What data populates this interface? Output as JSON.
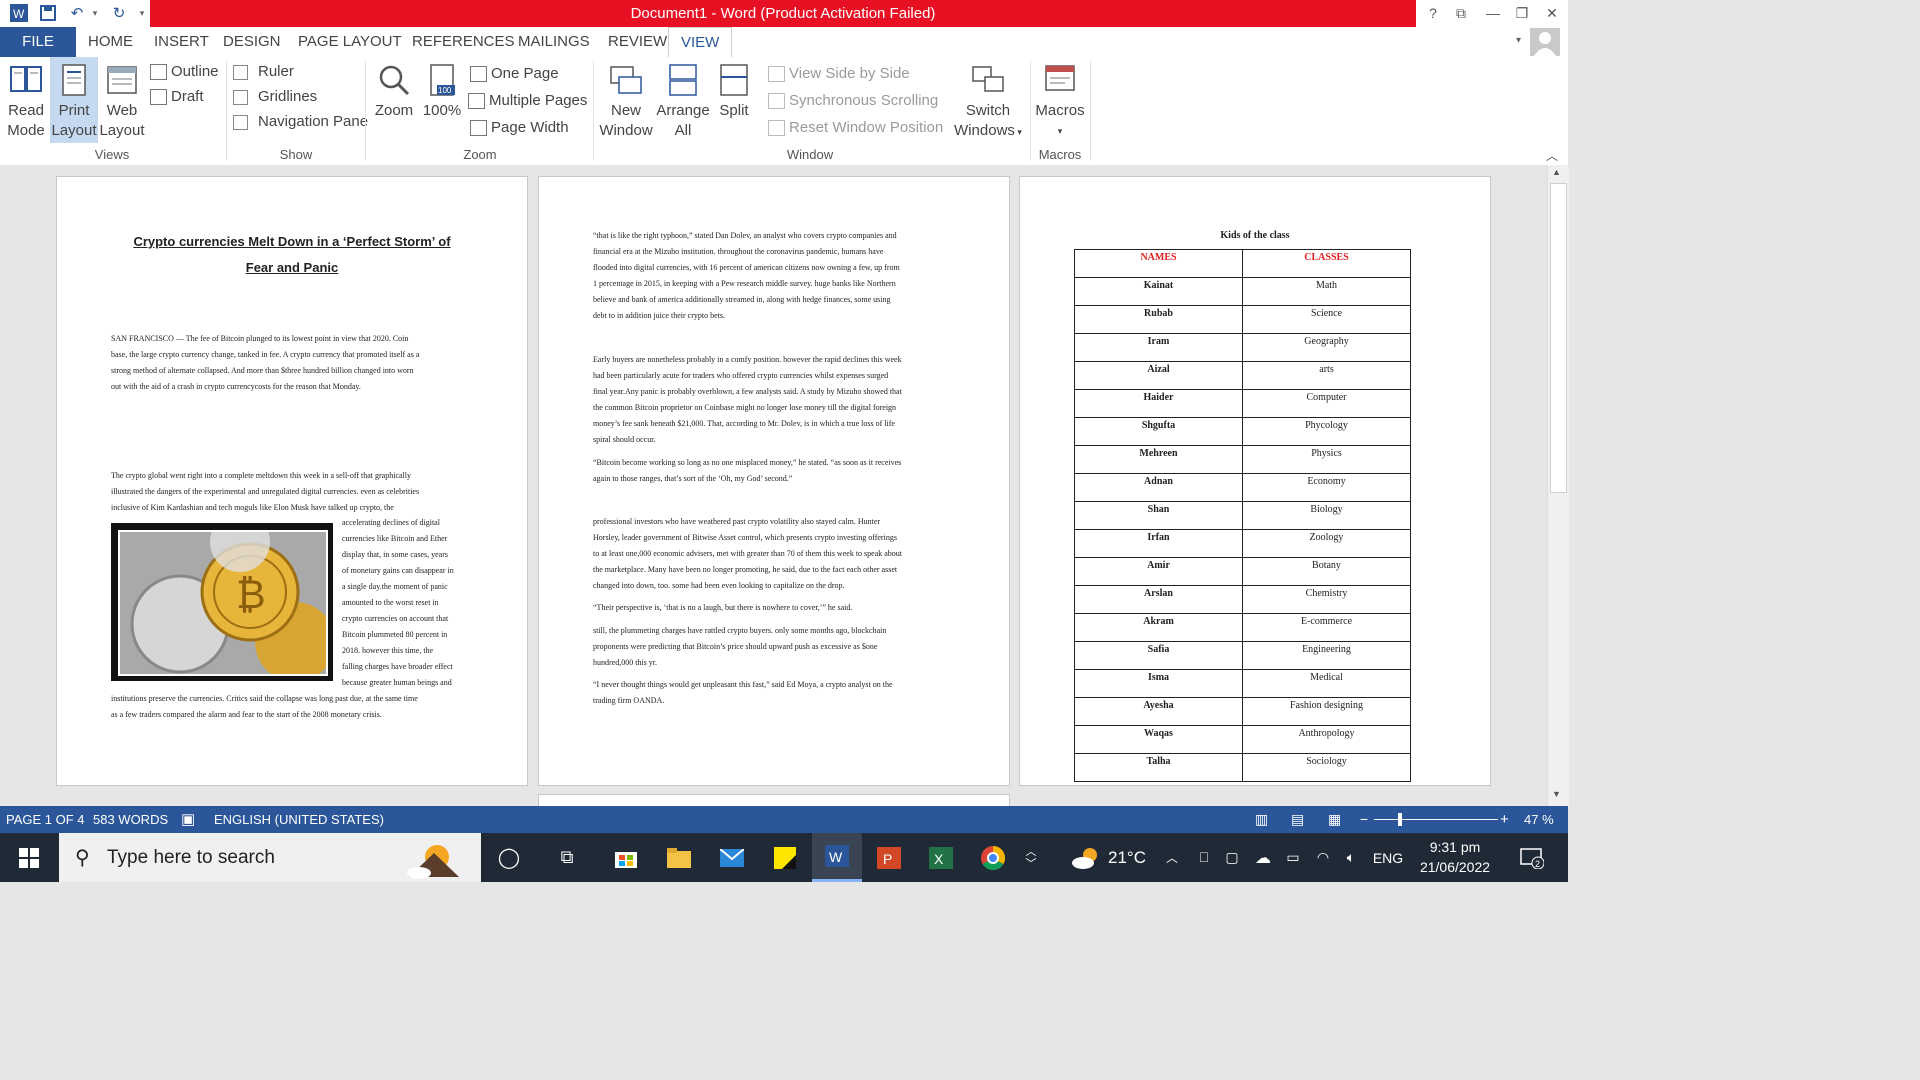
{
  "window": {
    "title": "Document1  -  Word (Product Activation Failed)",
    "help": "?"
  },
  "tabs": [
    "FILE",
    "HOME",
    "INSERT",
    "DESIGN",
    "PAGE LAYOUT",
    "REFERENCES",
    "MAILINGS",
    "REVIEW",
    "VIEW"
  ],
  "ribbon": {
    "views": {
      "label": "Views",
      "read_mode": [
        "Read",
        "Mode"
      ],
      "print_layout": [
        "Print",
        "Layout"
      ],
      "web_layout": [
        "Web",
        "Layout"
      ],
      "outline": "Outline",
      "draft": "Draft"
    },
    "show": {
      "label": "Show",
      "ruler": "Ruler",
      "gridlines": "Gridlines",
      "nav_pane": "Navigation Pane"
    },
    "zoom": {
      "label": "Zoom",
      "zoom": "Zoom",
      "hundred": "100%",
      "hundred_badge": "100",
      "one_page": "One Page",
      "multiple_pages": "Multiple Pages",
      "page_width": "Page Width"
    },
    "window": {
      "label": "Window",
      "new_window": [
        "New",
        "Window"
      ],
      "arrange_all": [
        "Arrange",
        "All"
      ],
      "split": "Split",
      "side_by_side": "View Side by Side",
      "sync_scroll": "Synchronous Scrolling",
      "reset_position": "Reset Window Position",
      "switch_windows": [
        "Switch",
        "Windows"
      ]
    },
    "macros": {
      "label": "Macros",
      "macros": "Macros"
    }
  },
  "page1": {
    "title_line1": "Crypto currencies Melt Down in a ‘Perfect Storm’ of",
    "title_line2": "Fear and Panic",
    "p1": [
      "SAN FRANCISCO — The fee of Bitcoin plunged to its lowest point in view that 2020. Coin",
      "base, the large crypto currency change, tanked in fee. A crypto currency that promoted itself as a",
      "strong method of alternate collapsed. And more than $three hundred billion changed into worn",
      "out with the aid of a crash in crypto currencycosts for the reason that Monday."
    ],
    "p2_top": [
      "The crypto global went right into a complete meltdown this week in a sell-off that graphically",
      "illustrated the dangers of the experimental and unregulated digital currencies. even as celebrities",
      "inclusive of Kim Kardashian and tech moguls like Elon Musk have talked up crypto, the"
    ],
    "p2_side": [
      "accelerating declines of digital",
      "currencies like Bitcoin and Ether",
      "display that, in some cases, years",
      "of monetary gains can disappear in",
      "a single day.the moment of panic",
      "amounted to the worst reset in",
      "crypto currencies on account that",
      "Bitcoin plummeted 80 percent in",
      "2018. however this time, the",
      "falling charges have broader effect",
      "because greater human beings and"
    ],
    "p2_bottom": [
      "institutions preserve the currencies. Critics said the collapse was long past due, at the same time",
      "as a few traders compared the alarm and fear to the start of the 2008 monetary crisis."
    ]
  },
  "page2": {
    "p1": [
      "“that is like the right typhoon,” stated Dan Dolev, an analyst who covers crypto companies and",
      "financial era at the Mizuho institution. throughout the coronavirus pandemic, humans have",
      "flooded into digital currencies, with 16 percent of american citizens now owning a few, up from",
      "1 percentage in 2015, in keeping with a Pew research middle survey. huge banks like Northern",
      "believe and bank of america additionally streamed in, along with hedge finances, some using",
      "debt to in addition juice their crypto bets."
    ],
    "p2": [
      "Early buyers are nonetheless probably in a comfy position. however the rapid declines this week",
      "had been particularly acute for traders who offered crypto currencies whilst expenses surged",
      "final year.Any panic is probably overblown, a few analysts said. A study by Mizuho showed that",
      "the common Bitcoin proprietor on Coinbase might no longer lose money till the digital foreign",
      "money’s fee sank beneath $21,000. That, according to Mr. Dolev, is in which a true loss of life",
      "spiral should occur."
    ],
    "p3": [
      "“Bitcoin become working so long as no one misplaced money,” he stated. “as soon as it receives",
      "again to those ranges, that’s sort of the ‘Oh, my God’ second.”"
    ],
    "p4": [
      "professional investors who have weathered past crypto volatility also stayed calm. Hunter",
      "Horsley, leader government of Bitwise Asset control, which presents crypto investing offerings",
      "to at least one,000 economic advisers, met with greater than 70 of them this week to speak about",
      "the marketplace. Many have been no longer promoting, he said, due to the fact each other asset",
      "changed into down, too. some had been even looking to capitalize on the drop."
    ],
    "p5": [
      "“Their perspective is, ‘that is no a laugh, but there is nowhere to cover,’” he said."
    ],
    "p6": [
      "still, the plummeting charges have rattled crypto buyers. only some months ago, blockchain",
      "proponents were predicting that Bitcoin’s price should upward push as excessive as $one",
      "hundred,000 this yr."
    ],
    "p7": [
      "“I never thought things would get unpleasant this fast,” said Ed Moya, a crypto analyst on the",
      "trading firm OANDA."
    ]
  },
  "page3": {
    "table_title": "Kids of the class",
    "headers": [
      "NAMES",
      "CLASSES"
    ],
    "rows": [
      [
        "Kainat",
        "Math"
      ],
      [
        "Rubab",
        "Science"
      ],
      [
        "Iram",
        "Geography"
      ],
      [
        "Aizal",
        "arts"
      ],
      [
        "Haider",
        "Computer"
      ],
      [
        "Shgufta",
        "Phycology"
      ],
      [
        "Mehreen",
        "Physics"
      ],
      [
        "Adnan",
        "Economy"
      ],
      [
        "Shan",
        "Biology"
      ],
      [
        "Irfan",
        "Zoology"
      ],
      [
        "Amir",
        "Botany"
      ],
      [
        "Arslan",
        "Chemistry"
      ],
      [
        "Akram",
        "E-commerce"
      ],
      [
        "Safia",
        "Engineering"
      ],
      [
        "Isma",
        "Medical"
      ],
      [
        "Ayesha",
        "Fashion designing"
      ],
      [
        "Waqas",
        "Anthropology"
      ],
      [
        "Talha",
        "Sociology"
      ]
    ]
  },
  "status": {
    "page": "PAGE 1 OF 4",
    "words": "583 WORDS",
    "language": "ENGLISH (UNITED STATES)",
    "zoom": "47 %"
  },
  "taskbar": {
    "search_placeholder": "Type here to search",
    "temp": "21°C",
    "lang": "ENG",
    "time": "9:31 pm",
    "date": "21/06/2022",
    "notif": "2"
  },
  "colors": {
    "accent": "#2b579a",
    "title_red": "#e81123",
    "taskbar": "#202a36",
    "table_header": "#e02020"
  }
}
